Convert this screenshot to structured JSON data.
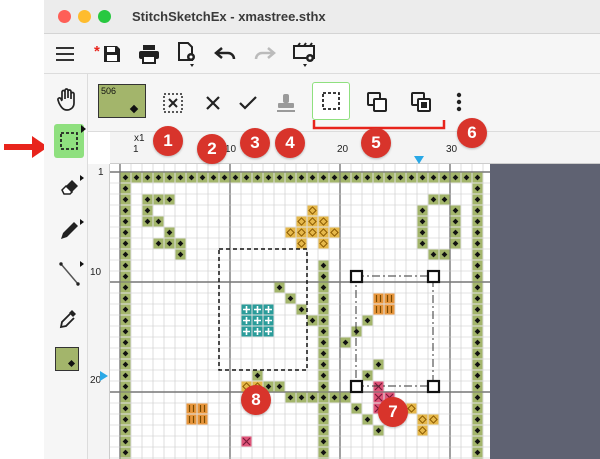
{
  "window": {
    "title": "StitchSketchEx - xmastree.sthx",
    "traffic_lights": [
      "#fe5f57",
      "#febc2e",
      "#28c840"
    ]
  },
  "toolbar": {
    "icons": [
      "menu-icon",
      "save-icon",
      "print-icon",
      "document-settings-icon",
      "undo-icon",
      "redo-icon",
      "canvas-settings-icon"
    ],
    "save_dirty_marker": "*"
  },
  "selection_toolbar": {
    "swatch_label": "506",
    "swatch_color": "#a3b56b",
    "icons": [
      "select-all-icon",
      "cancel-icon",
      "commit-icon",
      "stamp-icon",
      "rect-select-icon",
      "copy-icon",
      "paste-icon",
      "more-icon"
    ]
  },
  "left_tools": [
    "hand-tool",
    "rect-select-tool",
    "eraser-tool",
    "pencil-tool",
    "line-tool",
    "eyedropper-tool",
    "color-swatch"
  ],
  "ruler": {
    "top_labels": [
      "x1",
      "1",
      "10",
      "20",
      "30"
    ],
    "left_labels": [
      "1",
      "10",
      "20"
    ]
  },
  "callouts": [
    "1",
    "2",
    "3",
    "4",
    "5",
    "6",
    "7",
    "8"
  ],
  "colors": {
    "accent_green": "#8fe07f",
    "callout_red": "#d8342b",
    "arrow_red": "#e8241c",
    "dark_panel": "#5f6272",
    "stitch_green": "#a3b56b",
    "stitch_gold": "#e6b84a",
    "stitch_teal": "#2a9c9a",
    "stitch_orange": "#e8963c",
    "stitch_pink": "#e0557a"
  }
}
